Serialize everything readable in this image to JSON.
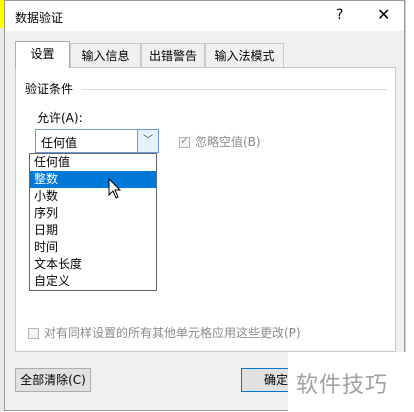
{
  "dialog": {
    "title": "数据验证",
    "help": "?",
    "close": "✕",
    "tabs": [
      "设置",
      "输入信息",
      "出错警告",
      "输入法模式"
    ],
    "active_tab": 0
  },
  "settings": {
    "group_label": "验证条件",
    "allow_label": "允许(A):",
    "combo_value": "任何值",
    "combo_arrow": "﹀",
    "ignore_blank": "忽略空值(B)",
    "ignore_blank_checked": true,
    "options": [
      "任何值",
      "整数",
      "小数",
      "序列",
      "日期",
      "时间",
      "文本长度",
      "自定义"
    ],
    "highlighted_option": 1,
    "apply_all": "对有同样设置的所有其他单元格应用这些更改(P)"
  },
  "buttons": {
    "clear_all": "全部清除(C)",
    "ok": "确定"
  },
  "watermark": "软件技巧",
  "colors": {
    "highlight": "#0078d7",
    "yellow_cell": "#ffff00"
  }
}
